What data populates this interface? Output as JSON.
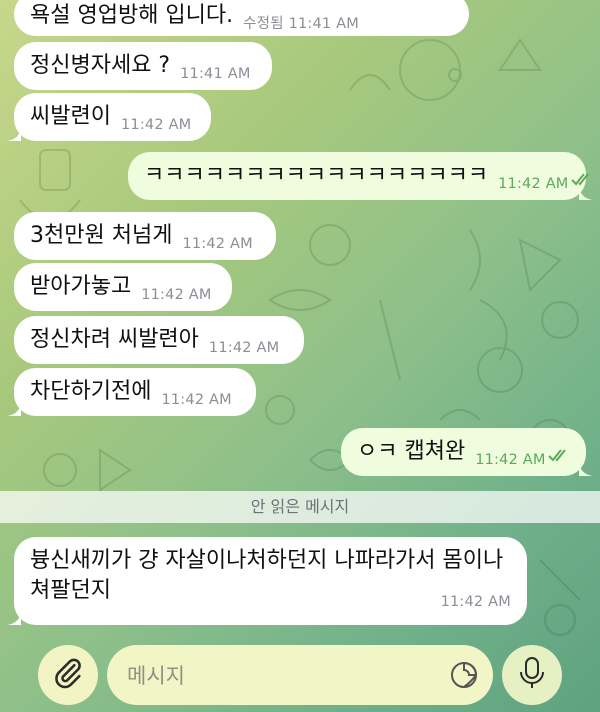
{
  "messages": [
    {
      "text": "욕설 영업방해 입니다.",
      "meta": "수정됨 11:41 AM",
      "dir": "in"
    },
    {
      "text": "정신병자세요 ?",
      "meta": "11:41 AM",
      "dir": "in"
    },
    {
      "text": "씨발련이",
      "meta": "11:42 AM",
      "dir": "in"
    },
    {
      "text": "ㅋㅋㅋㅋㅋㅋㅋㅋㅋㅋㅋㅋㅋㅋㅋㅋㅋ",
      "meta": "11:42 AM",
      "dir": "out",
      "status": "read"
    },
    {
      "text": "3천만원 처넘게",
      "meta": "11:42 AM",
      "dir": "in"
    },
    {
      "text": "받아가놓고",
      "meta": "11:42 AM",
      "dir": "in"
    },
    {
      "text": "정신차려 씨발련아",
      "meta": "11:42 AM",
      "dir": "in"
    },
    {
      "text": "차단하기전에",
      "meta": "11:42 AM",
      "dir": "in"
    },
    {
      "text": "ㅇㅋ 캡쳐완",
      "meta": "11:42 AM",
      "dir": "out",
      "status": "read"
    }
  ],
  "unread_divider": "안 읽은 메시지",
  "last_message": {
    "text": "븅신새끼가 걍 자살이나처하던지 나파라가서 몸이나 쳐팔던지",
    "meta": "11:42 AM",
    "dir": "in"
  },
  "composer": {
    "placeholder": "메시지"
  },
  "icons": {
    "attach": "paperclip-icon",
    "sticker": "sticker-icon",
    "mic": "microphone-icon",
    "read": "double-check-icon"
  },
  "colors": {
    "incoming": "#ffffff",
    "outgoing": "#effdde",
    "read_check": "#5da85a"
  }
}
